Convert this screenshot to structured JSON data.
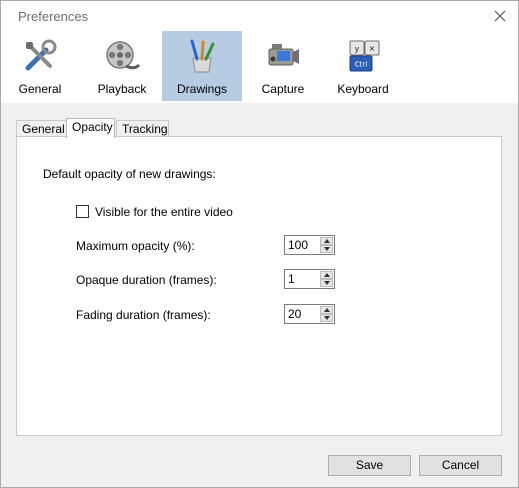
{
  "window": {
    "title": "Preferences"
  },
  "toolbar": {
    "items": [
      {
        "label": "General",
        "icon": "tools-icon"
      },
      {
        "label": "Playback",
        "icon": "film-reel-icon"
      },
      {
        "label": "Drawings",
        "icon": "brushes-icon",
        "active": true
      },
      {
        "label": "Capture",
        "icon": "camcorder-icon"
      },
      {
        "label": "Keyboard",
        "icon": "keyboard-keys-icon"
      }
    ],
    "active_color": "#b7cbe3"
  },
  "tabs": [
    {
      "label": "General"
    },
    {
      "label": "Opacity",
      "active": true
    },
    {
      "label": "Tracking"
    }
  ],
  "opacity": {
    "section_label": "Default opacity of new drawings:",
    "visible_entire_video": {
      "label": "Visible for the entire video",
      "checked": false
    },
    "max_opacity": {
      "label": "Maximum opacity (%):",
      "value": "100"
    },
    "opaque_duration": {
      "label": "Opaque duration (frames):",
      "value": "1"
    },
    "fading_duration": {
      "label": "Fading duration (frames):",
      "value": "20"
    }
  },
  "buttons": {
    "save": "Save",
    "cancel": "Cancel"
  }
}
